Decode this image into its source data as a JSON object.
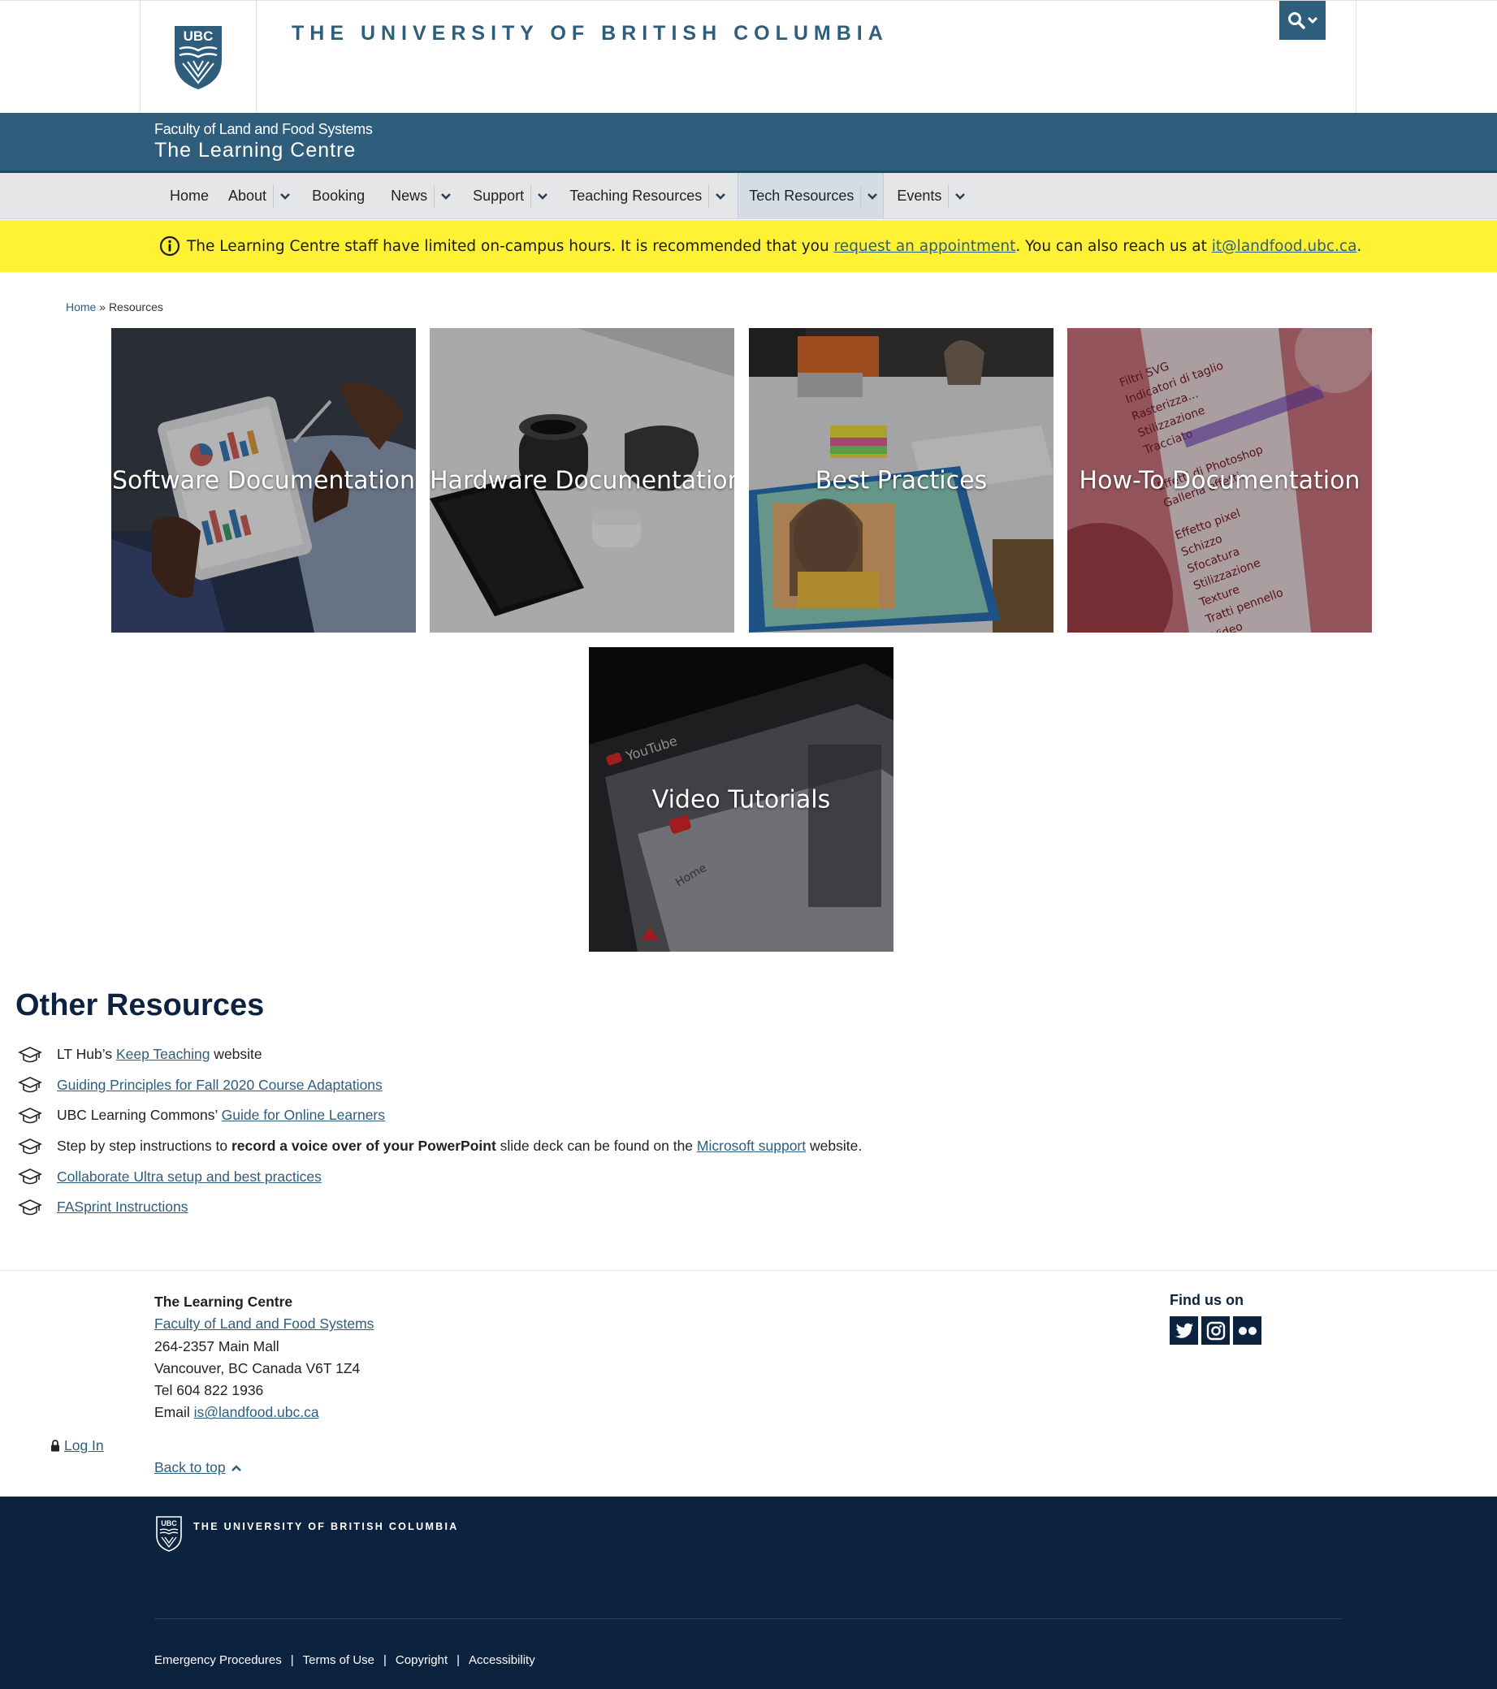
{
  "header": {
    "university_title": "THE UNIVERSITY OF BRITISH COLUMBIA",
    "logo_text": "UBC"
  },
  "unit": {
    "faculty": "Faculty of Land and Food Systems",
    "name": "The Learning Centre"
  },
  "nav": {
    "home": "Home",
    "about": "About",
    "booking": "Booking",
    "news": "News",
    "support": "Support",
    "teaching_resources": "Teaching Resources",
    "tech_resources": "Tech Resources",
    "events": "Events"
  },
  "alert": {
    "text_1": "The Learning Centre staff have limited on-campus hours. It is recommended that you ",
    "link_1": "request an appointment",
    "text_2": ". You can also reach us at ",
    "link_2": "it@landfood.ubc.ca",
    "text_3": "."
  },
  "breadcrumb": {
    "home": "Home",
    "separator": "»",
    "current": "Resources"
  },
  "tiles": [
    {
      "label": "Software Documentation"
    },
    {
      "label": "Hardware Documentation"
    },
    {
      "label": "Best Practices"
    },
    {
      "label": "How-To Documentation"
    },
    {
      "label": "Video Tutorials"
    }
  ],
  "other_resources": {
    "heading": "Other Resources",
    "items": [
      {
        "pre": "LT Hub’s ",
        "link": "Keep Teaching",
        "post": " website"
      },
      {
        "pre": "",
        "link": "Guiding Principles for Fall 2020 Course Adaptations",
        "post": ""
      },
      {
        "pre": "UBC Learning Commons’ ",
        "link": "Guide for Online Learners",
        "post": ""
      },
      {
        "pre": "Step by step instructions to ",
        "bold": "record a voice over of your PowerPoint",
        "mid": " slide deck can be found on the ",
        "link": "Microsoft support",
        "post": " website."
      },
      {
        "pre": "",
        "link": "Collaborate Ultra setup and best practices",
        "post": ""
      },
      {
        "pre": "",
        "link": "FASprint Instructions",
        "post": ""
      }
    ]
  },
  "footer": {
    "unit_name": "The Learning Centre",
    "faculty_link": "Faculty of Land and Food Systems",
    "address_1": "264-2357 Main Mall",
    "address_2": "Vancouver, BC Canada V6T 1Z4",
    "tel": "Tel 604 822 1936",
    "email_label": "Email ",
    "email": "is@landfood.ubc.ca",
    "find_us": "Find us on",
    "login": "Log In",
    "back_to_top": "Back to top"
  },
  "ubc_footer": {
    "brand": "THE UNIVERSITY OF BRITISH COLUMBIA",
    "links": [
      "Emergency Procedures",
      "Terms of Use",
      "Copyright",
      "Accessibility"
    ]
  },
  "colors": {
    "ubc_blue": "#2f5d7c",
    "navy": "#0c2340",
    "alert_yellow": "#fff235",
    "nav_gray": "#e5e6e8"
  },
  "icons": [
    "search-icon",
    "chevron-down-icon",
    "info-icon",
    "graduation-cap-icon",
    "twitter-icon",
    "instagram-icon",
    "flickr-icon",
    "lock-icon",
    "chevron-up-icon",
    "ubc-crest-icon"
  ]
}
